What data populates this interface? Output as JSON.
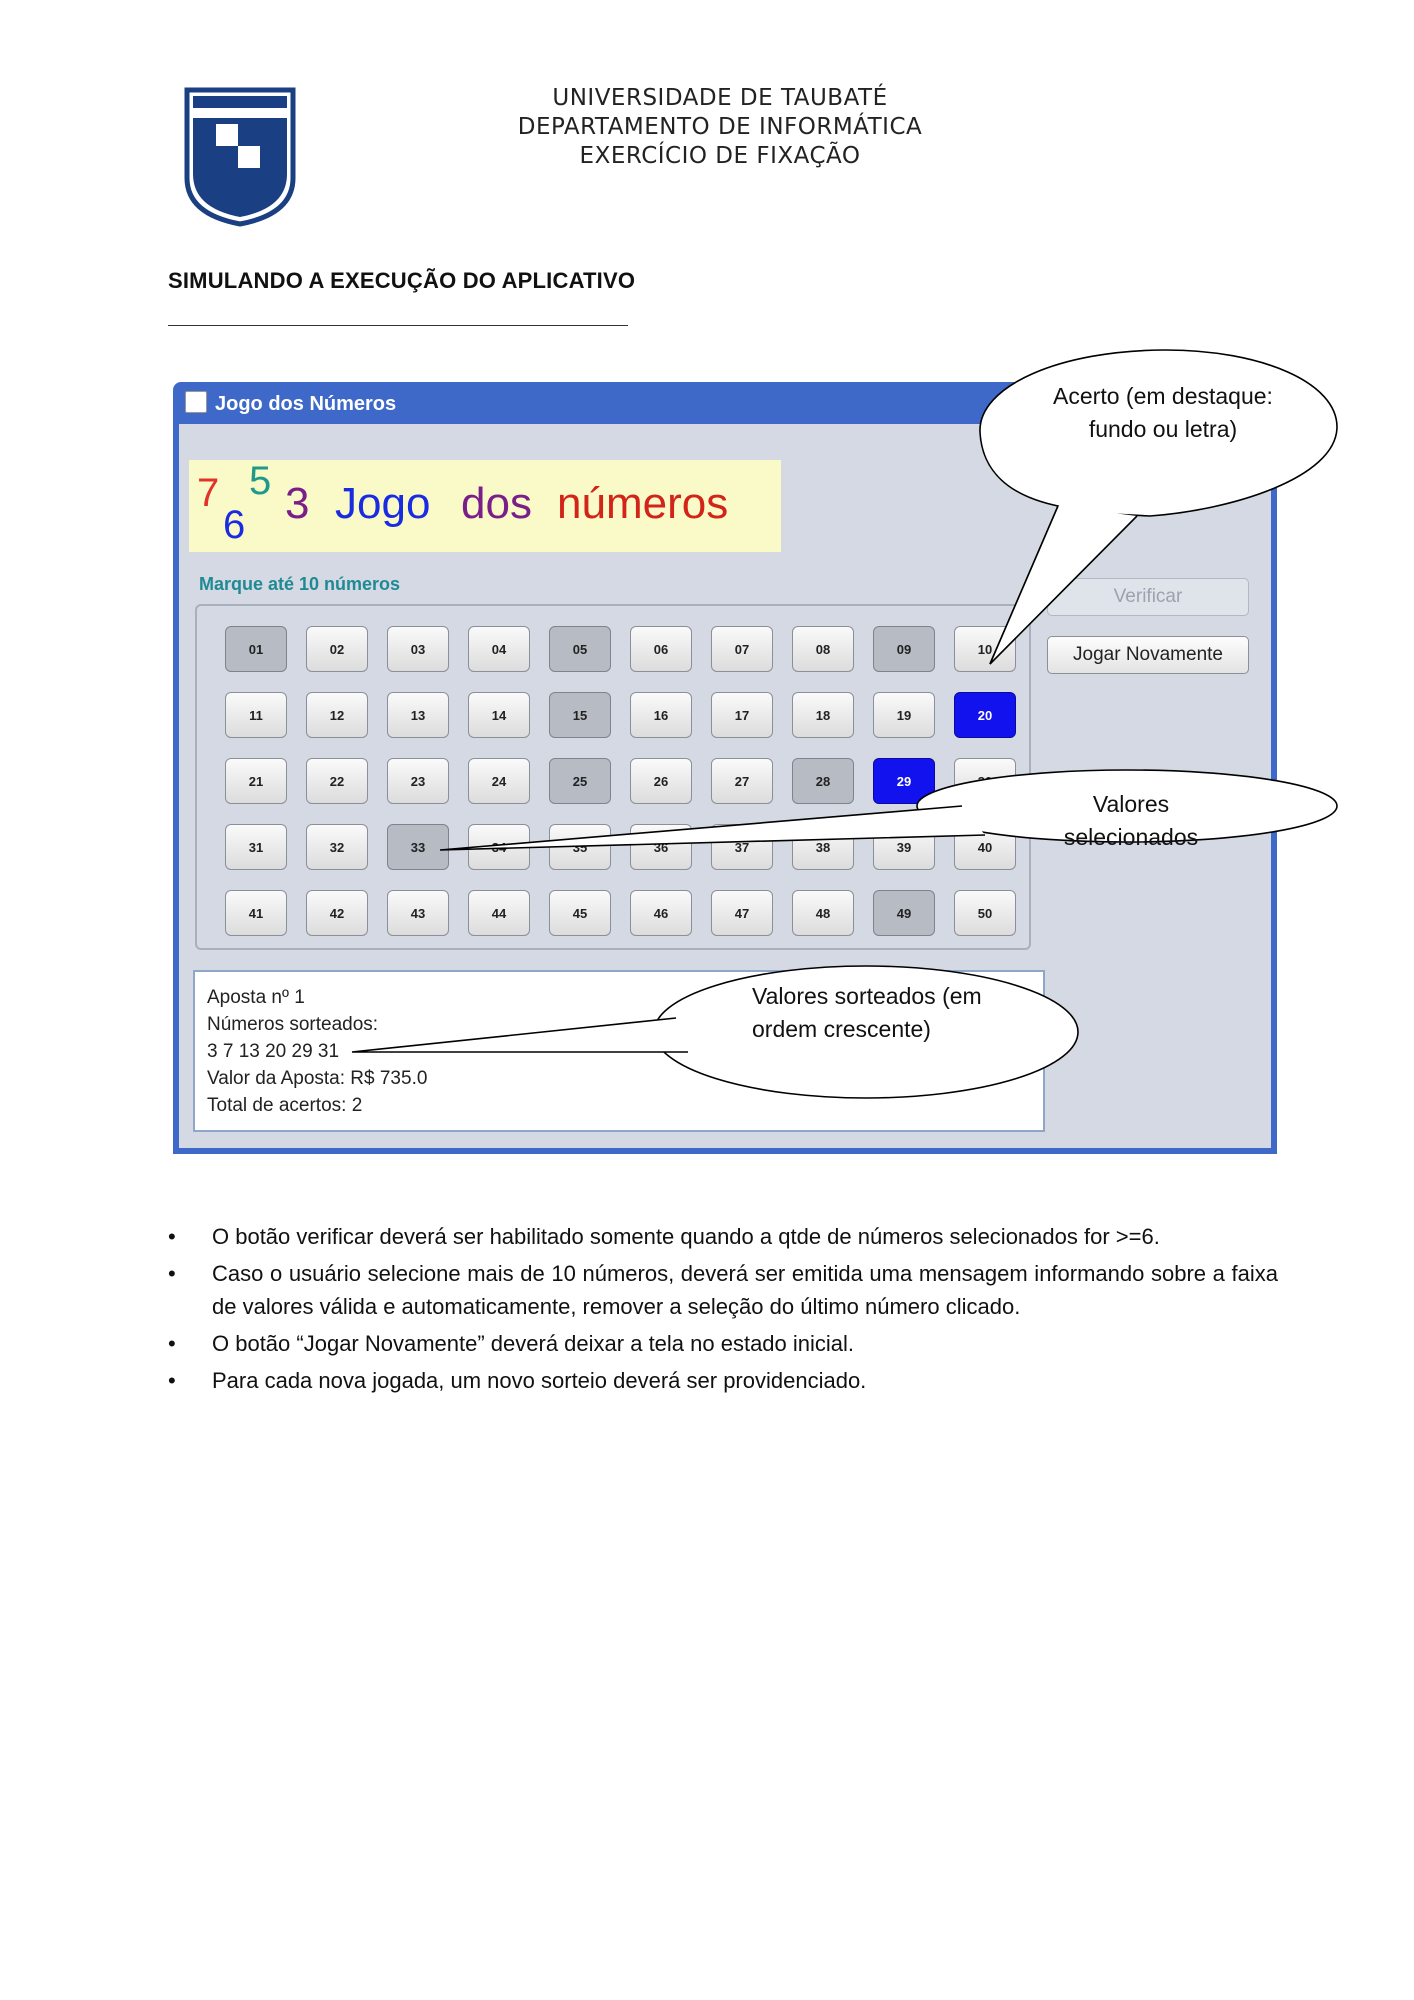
{
  "header": {
    "university": "UNIVERSIDADE DE TAUBATÉ",
    "department": "DEPARTAMENTO DE INFORMÁTICA",
    "exercise": "EXERCÍCIO DE FIXAÇÃO"
  },
  "section_title": "SIMULANDO A EXECUÇÃO DO APLICATIVO",
  "app": {
    "window_title": "Jogo dos Números",
    "banner": {
      "n1": "7",
      "n2": "6",
      "n3": "5",
      "n4": "3",
      "w1": "Jogo",
      "w2": "dos",
      "w3": "números"
    },
    "mark_label": "Marque até 10 números",
    "numbers": [
      "01",
      "02",
      "03",
      "04",
      "05",
      "06",
      "07",
      "08",
      "09",
      "10",
      "11",
      "12",
      "13",
      "14",
      "15",
      "16",
      "17",
      "18",
      "19",
      "20",
      "21",
      "22",
      "23",
      "24",
      "25",
      "26",
      "27",
      "28",
      "29",
      "30",
      "31",
      "32",
      "33",
      "34",
      "35",
      "36",
      "37",
      "38",
      "39",
      "40",
      "41",
      "42",
      "43",
      "44",
      "45",
      "46",
      "47",
      "48",
      "49",
      "50"
    ],
    "selected": [
      "01",
      "05",
      "09",
      "15",
      "25",
      "28",
      "33",
      "49"
    ],
    "hits": [
      "20",
      "29"
    ],
    "verify_label": "Verificar",
    "play_again_label": "Jogar Novamente",
    "result": {
      "bet": "Aposta nº 1",
      "drawn_label": "Números sorteados:",
      "drawn_numbers": "3 7 13 20 29 31",
      "bet_value": "Valor da Aposta: R$ 735.0",
      "total_hits": "Total de acertos: 2"
    }
  },
  "callouts": {
    "hit_line1": "Acerto (em destaque:",
    "hit_line2": "fundo ou letra)",
    "selected": "Valores selecionados",
    "drawn_line1": "Valores  sorteados  (em",
    "drawn_line2": "ordem crescente)"
  },
  "bullets": [
    "O botão verificar deverá ser habilitado somente quando a qtde de números selecionados for >=6.",
    "Caso o usuário selecione mais de 10 números, deverá ser emitida uma mensagem informando sobre a faixa de valores válida e automaticamente, remover a seleção do último número clicado.",
    "O botão “Jogar Novamente” deverá deixar a tela no estado inicial.",
    "Para cada nova jogada, um novo sorteio deverá ser providenciado."
  ]
}
